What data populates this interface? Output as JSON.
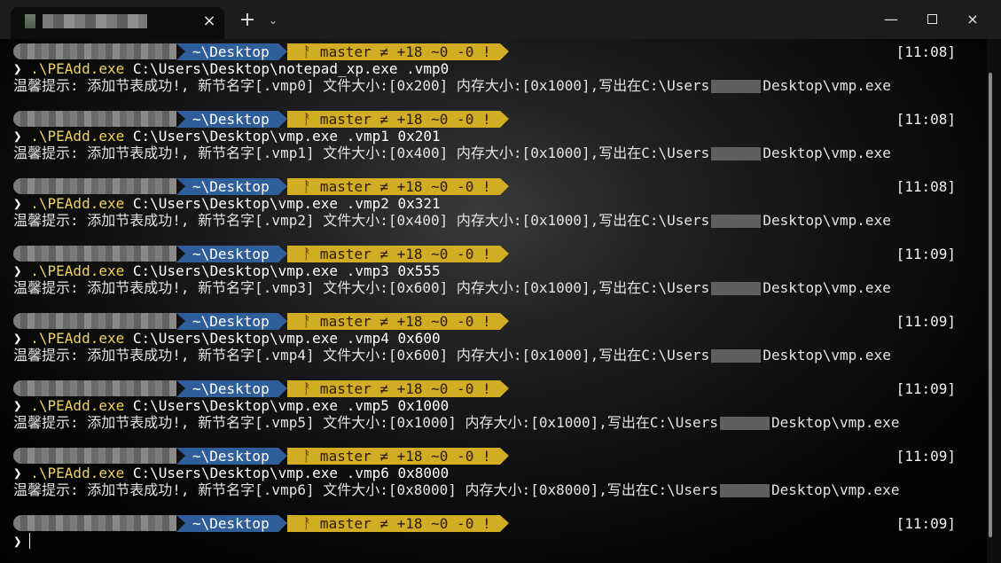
{
  "window": {
    "tab": {
      "icon": "terminal-icon",
      "title": "",
      "close_label": "×"
    },
    "new_tab_label": "+",
    "dropdown_label": "⌄",
    "controls": {
      "minimize": "—",
      "maximize": "□",
      "close": "×"
    }
  },
  "colors": {
    "path_segment": "#2f5e9a",
    "git_segment": "#d0ad23",
    "command": "#f0d45d"
  },
  "terminal": {
    "blocks": [
      {
        "path": "~\\Desktop",
        "git": "ᚨ master ≠ +18 ~0 -0 !",
        "time": "[11:08]",
        "command_exe": ".\\PEAdd.exe",
        "command_args": "C:\\Users\\Desktop\\notepad_xp.exe .vmp0",
        "output_before": "温馨提示: 添加节表成功!, 新节名字[.vmp0] 文件大小:[0x200] 内存大小:[0x1000],写出在C:\\Users",
        "output_after": "Desktop\\vmp.exe"
      },
      {
        "path": "~\\Desktop",
        "git": "ᚨ master ≠ +18 ~0 -0 !",
        "time": "[11:08]",
        "command_exe": ".\\PEAdd.exe",
        "command_args": "C:\\Users\\Desktop\\vmp.exe .vmp1 0x201",
        "output_before": "温馨提示: 添加节表成功!, 新节名字[.vmp1] 文件大小:[0x400] 内存大小:[0x1000],写出在C:\\Users",
        "output_after": "Desktop\\vmp.exe"
      },
      {
        "path": "~\\Desktop",
        "git": "ᚨ master ≠ +18 ~0 -0 !",
        "time": "[11:08]",
        "command_exe": ".\\PEAdd.exe",
        "command_args": "C:\\Users\\Desktop\\vmp.exe .vmp2 0x321",
        "output_before": "温馨提示: 添加节表成功!, 新节名字[.vmp2] 文件大小:[0x400] 内存大小:[0x1000],写出在C:\\Users",
        "output_after": "Desktop\\vmp.exe"
      },
      {
        "path": "~\\Desktop",
        "git": "ᚨ master ≠ +18 ~0 -0 !",
        "time": "[11:09]",
        "command_exe": ".\\PEAdd.exe",
        "command_args": "C:\\Users\\Desktop\\vmp.exe .vmp3 0x555",
        "output_before": "温馨提示: 添加节表成功!, 新节名字[.vmp3] 文件大小:[0x600] 内存大小:[0x1000],写出在C:\\Users",
        "output_after": "Desktop\\vmp.exe"
      },
      {
        "path": "~\\Desktop",
        "git": "ᚨ master ≠ +18 ~0 -0 !",
        "time": "[11:09]",
        "command_exe": ".\\PEAdd.exe",
        "command_args": "C:\\Users\\Desktop\\vmp.exe .vmp4 0x600",
        "output_before": "温馨提示: 添加节表成功!, 新节名字[.vmp4] 文件大小:[0x600] 内存大小:[0x1000],写出在C:\\Users",
        "output_after": "Desktop\\vmp.exe"
      },
      {
        "path": "~\\Desktop",
        "git": "ᚨ master ≠ +18 ~0 -0 !",
        "time": "[11:09]",
        "command_exe": ".\\PEAdd.exe",
        "command_args": "C:\\Users\\Desktop\\vmp.exe .vmp5 0x1000",
        "output_before": "温馨提示: 添加节表成功!, 新节名字[.vmp5] 文件大小:[0x1000] 内存大小:[0x1000],写出在C:\\Users",
        "output_after": "Desktop\\vmp.exe"
      },
      {
        "path": "~\\Desktop",
        "git": "ᚨ master ≠ +18 ~0 -0 !",
        "time": "[11:09]",
        "command_exe": ".\\PEAdd.exe",
        "command_args": "C:\\Users\\Desktop\\vmp.exe .vmp6 0x8000",
        "output_before": "温馨提示: 添加节表成功!, 新节名字[.vmp6] 文件大小:[0x8000] 内存大小:[0x8000],写出在C:\\Users",
        "output_after": "Desktop\\vmp.exe"
      },
      {
        "path": "~\\Desktop",
        "git": "ᚨ master ≠ +18 ~0 -0 !",
        "time": "[11:09]"
      }
    ],
    "cursor_prompt": "❯"
  }
}
